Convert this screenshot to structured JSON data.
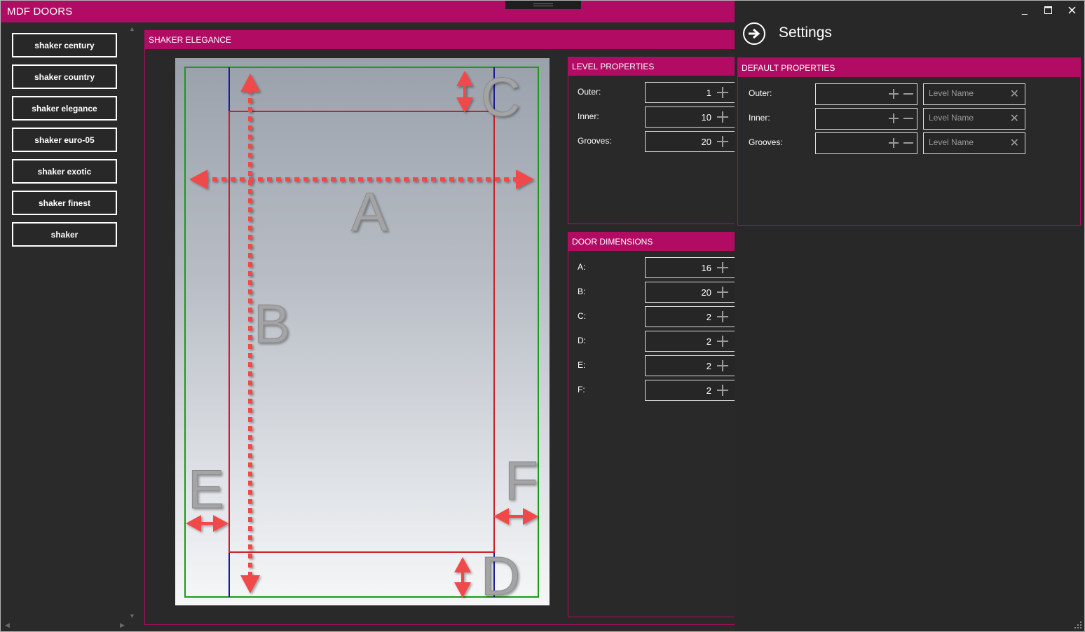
{
  "app": {
    "title": "MDF DOORS"
  },
  "sidebar": {
    "items": [
      {
        "label": "shaker century"
      },
      {
        "label": "shaker country"
      },
      {
        "label": "shaker elegance"
      },
      {
        "label": "shaker euro-05"
      },
      {
        "label": "shaker exotic"
      },
      {
        "label": "shaker finest"
      },
      {
        "label": "shaker"
      }
    ]
  },
  "main": {
    "header": "SHAKER ELEGANCE",
    "diagram_letters": {
      "a": "A",
      "b": "B",
      "c": "C",
      "d": "D",
      "e": "E",
      "f": "F"
    }
  },
  "level_properties": {
    "header": "LEVEL PROPERTIES",
    "fields": [
      {
        "label": "Outer:",
        "value": "1"
      },
      {
        "label": "Inner:",
        "value": "10"
      },
      {
        "label": "Grooves:",
        "value": "20"
      }
    ]
  },
  "door_dimensions": {
    "header": "DOOR DIMENSIONS",
    "fields": [
      {
        "label": "A:",
        "value": "16"
      },
      {
        "label": "B:",
        "value": "20"
      },
      {
        "label": "C:",
        "value": "2"
      },
      {
        "label": "D:",
        "value": "2"
      },
      {
        "label": "E:",
        "value": "2"
      },
      {
        "label": "F:",
        "value": "2"
      }
    ]
  },
  "settings": {
    "title": "Settings",
    "default_properties": {
      "header": "DEFAULT PROPERTIES",
      "fields": [
        {
          "label": "Outer:",
          "placeholder": "Level Name"
        },
        {
          "label": "Inner:",
          "placeholder": "Level Name"
        },
        {
          "label": "Grooves:",
          "placeholder": "Level Name"
        }
      ]
    }
  },
  "colors": {
    "accent": "#b10b63",
    "background": "#2a2a2a",
    "arrow": "#f04848",
    "inner_frame": "#cc1f2a",
    "outer_frame": "#1a9a1a",
    "guide": "#1a1a9a"
  },
  "icons": {
    "back": "arrow-right-circle-icon",
    "minimize": "minimize-icon",
    "maximize": "maximize-icon",
    "close": "close-icon"
  }
}
